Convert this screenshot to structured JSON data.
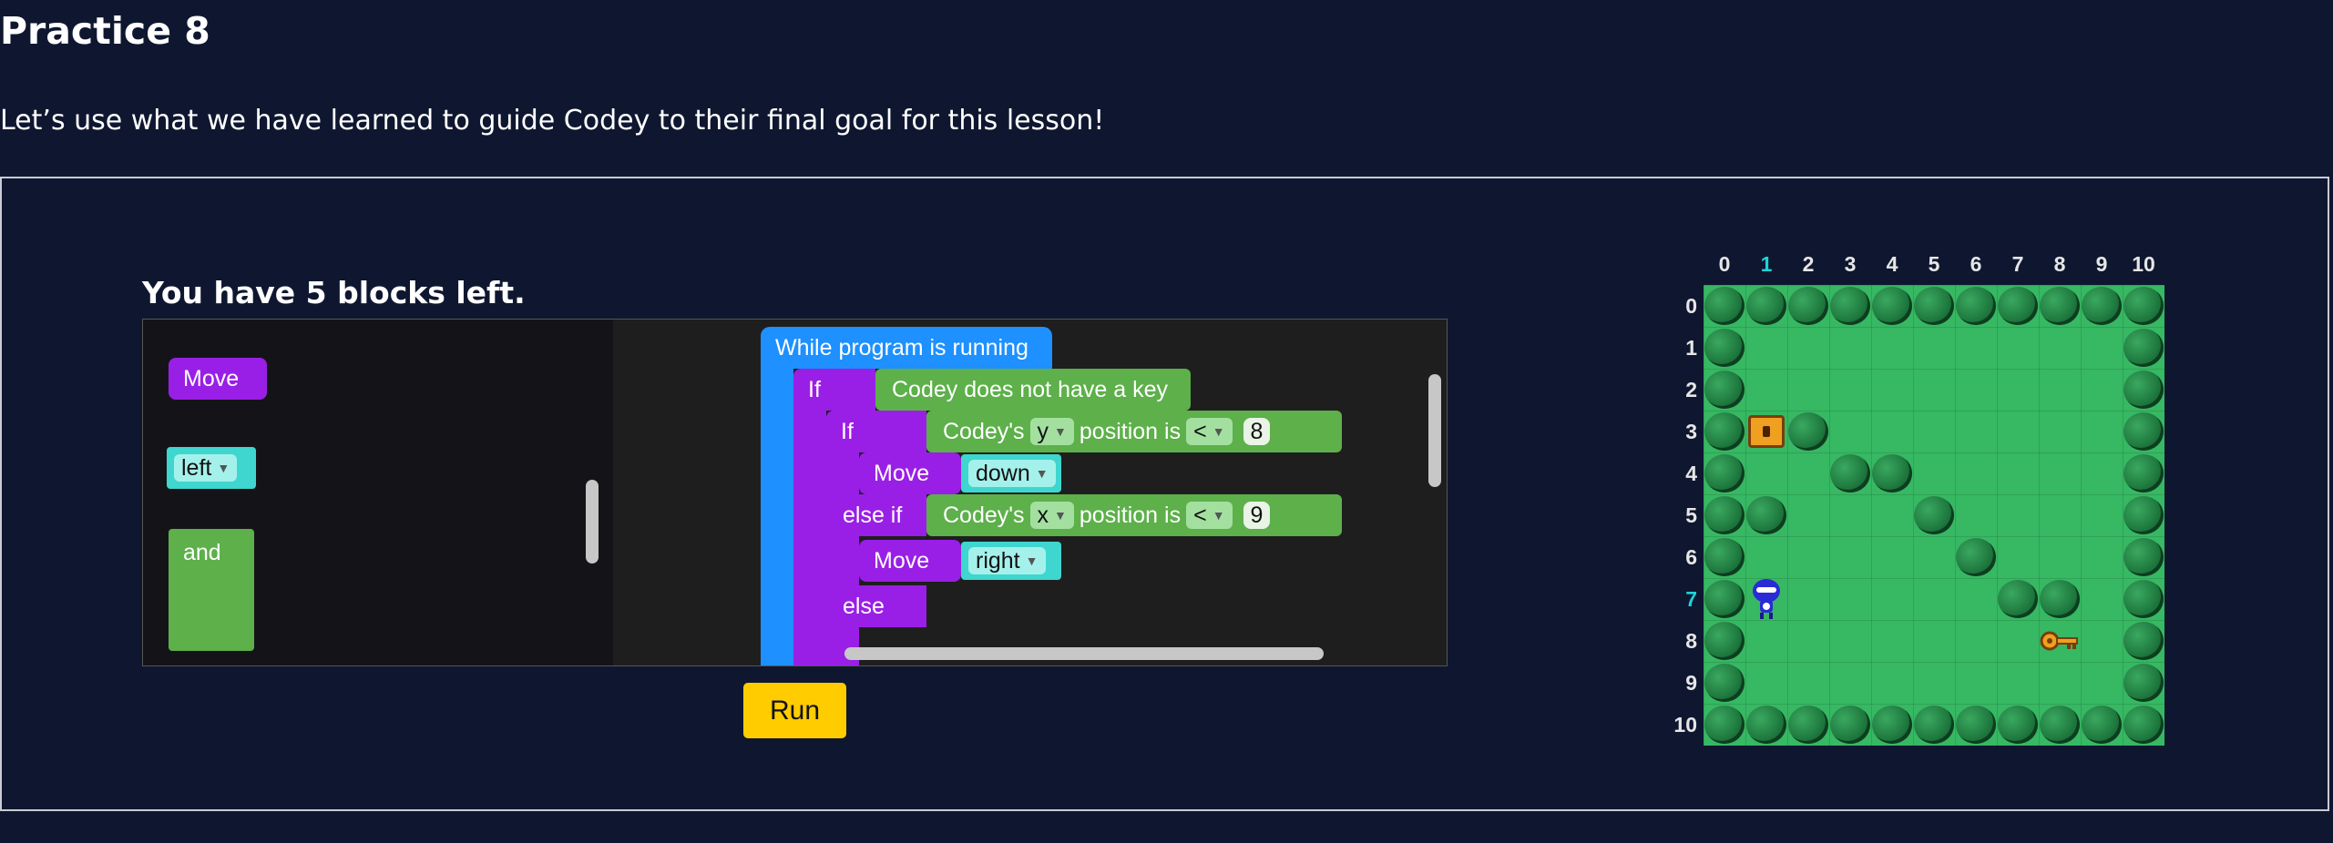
{
  "page": {
    "title": "Practice 8",
    "description": "Let’s use what we have learned to guide Codey to their final goal for this lesson!"
  },
  "editor": {
    "blocks_left": "You have 5 blocks left.",
    "toolbox": {
      "move": "Move",
      "left": "left",
      "and": "and"
    },
    "program": {
      "while": "While program is running",
      "if1": "If",
      "cond1": "Codey does not have a key",
      "if2": "If",
      "codeys": "Codey's",
      "axis_y": "y",
      "position_is": "position is",
      "op1": "<",
      "val1": "8",
      "move1": "Move",
      "dir1": "down",
      "elseif": "else if",
      "axis_x": "x",
      "op2": "<",
      "val2": "9",
      "move2": "Move",
      "dir2": "right",
      "else": "else"
    },
    "run_label": "Run"
  },
  "map": {
    "x_labels": [
      "0",
      "1",
      "2",
      "3",
      "4",
      "5",
      "6",
      "7",
      "8",
      "9",
      "10"
    ],
    "y_labels": [
      "0",
      "1",
      "2",
      "3",
      "4",
      "5",
      "6",
      "7",
      "8",
      "9",
      "10"
    ],
    "highlight_x": "1",
    "highlight_y": "7",
    "codey": {
      "x": 1,
      "y": 7
    },
    "chest": {
      "x": 1,
      "y": 3
    },
    "key": {
      "x": 8,
      "y": 8
    },
    "bushes": [
      [
        0,
        0
      ],
      [
        1,
        0
      ],
      [
        2,
        0
      ],
      [
        3,
        0
      ],
      [
        4,
        0
      ],
      [
        5,
        0
      ],
      [
        6,
        0
      ],
      [
        7,
        0
      ],
      [
        8,
        0
      ],
      [
        9,
        0
      ],
      [
        10,
        0
      ],
      [
        0,
        1
      ],
      [
        10,
        1
      ],
      [
        0,
        2
      ],
      [
        10,
        2
      ],
      [
        0,
        3
      ],
      [
        2,
        3
      ],
      [
        10,
        3
      ],
      [
        0,
        4
      ],
      [
        3,
        4
      ],
      [
        4,
        4
      ],
      [
        10,
        4
      ],
      [
        0,
        5
      ],
      [
        1,
        5
      ],
      [
        5,
        5
      ],
      [
        10,
        5
      ],
      [
        0,
        6
      ],
      [
        6,
        6
      ],
      [
        10,
        6
      ],
      [
        0,
        7
      ],
      [
        7,
        7
      ],
      [
        8,
        7
      ],
      [
        10,
        7
      ],
      [
        0,
        8
      ],
      [
        10,
        8
      ],
      [
        0,
        9
      ],
      [
        10,
        9
      ],
      [
        0,
        10
      ],
      [
        1,
        10
      ],
      [
        2,
        10
      ],
      [
        3,
        10
      ],
      [
        4,
        10
      ],
      [
        5,
        10
      ],
      [
        6,
        10
      ],
      [
        7,
        10
      ],
      [
        8,
        10
      ],
      [
        9,
        10
      ],
      [
        10,
        10
      ]
    ],
    "colors": {
      "grass": "#37b863",
      "highlight": "#1dd3d6"
    }
  }
}
